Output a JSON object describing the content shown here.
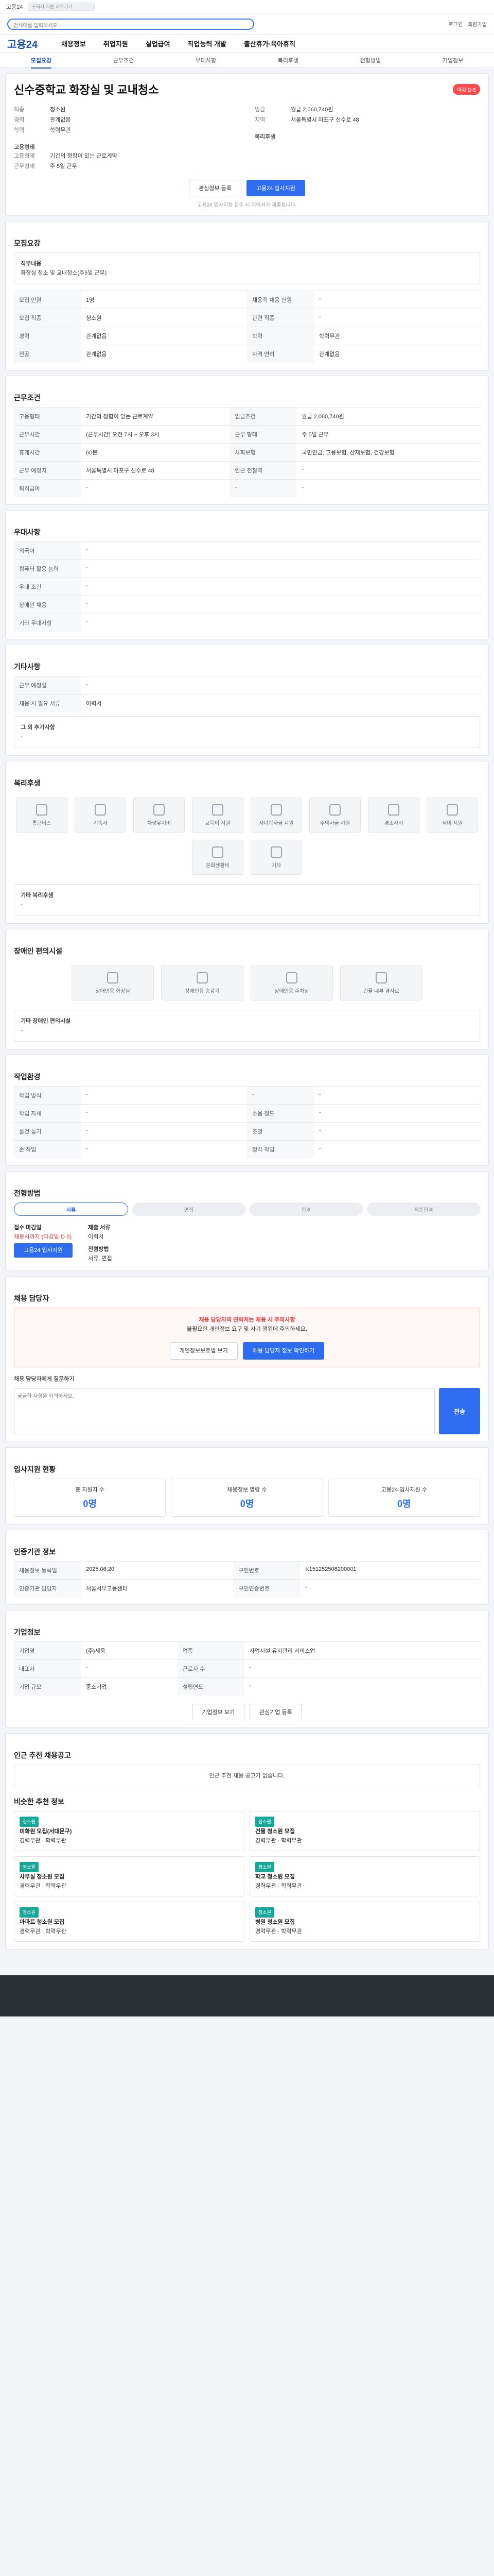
{
  "topbar": {
    "logo": "고용24",
    "notice": "구직자 지원 바로가기"
  },
  "header": {
    "search_placeholder": "검색어를 입력하세요",
    "links": [
      "로그인",
      "회원가입"
    ]
  },
  "nav": {
    "org": "고용24",
    "items": [
      "채용정보",
      "취업지원",
      "실업급여",
      "직업능력 개발",
      "출산휴가·육아휴직"
    ]
  },
  "tabs": [
    "모집요강",
    "근무조건",
    "우대사항",
    "복리후생",
    "전형방법",
    "기업정보"
  ],
  "job": {
    "title": "신수중학교 화장실 및 교내청소",
    "badge": "마감 D-5",
    "left": [
      {
        "k": "직종",
        "v": "청소원"
      },
      {
        "k": "경력",
        "v": "관계없음"
      },
      {
        "k": "학력",
        "v": "학력무관"
      }
    ],
    "right": [
      {
        "k": "임금",
        "v": "월급 2,060,740원"
      },
      {
        "k": "지역",
        "v": "서울특별시 마포구 신수로 48"
      }
    ],
    "type_label": "고용형태",
    "type_rows": [
      {
        "k": "고용형태",
        "v": "기간의 정함이 있는 근로계약"
      },
      {
        "k": "근무형태",
        "v": "주 5일 근무"
      }
    ],
    "extra_label": "복리후생",
    "btn_scrap": "관심정보 등록",
    "btn_apply": "고용24 입사지원",
    "apply_note": "고용24 입사지원 접수 시 이력서가 제출됩니다."
  },
  "recruit": {
    "title": "모집요강",
    "duty_label": "직무내용",
    "duty": "화장실 청소 및 교내청소(주5일 근무)",
    "rows": [
      [
        "모집 인원",
        "1명",
        "채용직 채용 인원",
        "-"
      ],
      [
        "모집 직종",
        "청소원",
        "관련 직종",
        "-"
      ],
      [
        "경력",
        "관계없음",
        "학력",
        "학력무관"
      ],
      [
        "전공",
        "관계없음",
        "자격 면허",
        "관계없음"
      ]
    ]
  },
  "conditions": {
    "title": "근무조건",
    "rows": [
      [
        "고용형태",
        "기간의 정함이 있는 근로계약",
        "임금조건",
        "월급 2,060,740원"
      ],
      [
        "근무시간",
        "(근무시간) 오전 7시 ~ 오후 3시",
        "근무 형태",
        "주 5일 근무"
      ],
      [
        "휴게시간",
        "60분",
        "사회보험",
        "국민연금, 고용보험, 산재보험, 건강보험"
      ],
      [
        "근무 예정지",
        "서울특별시 마포구 신수로 48",
        "인근 전철역",
        "-"
      ],
      [
        "퇴직급여",
        "-",
        "-",
        "-"
      ]
    ]
  },
  "preferences": {
    "title": "우대사항",
    "rows": [
      [
        "외국어",
        "-"
      ],
      [
        "컴퓨터 활용 능력",
        "-"
      ],
      [
        "우대 조건",
        "-"
      ],
      [
        "장애인 채용",
        "-"
      ],
      [
        "기타 우대사항",
        "-"
      ]
    ]
  },
  "etc": {
    "title": "기타사항",
    "rows": [
      [
        "근무 예정일",
        "-"
      ],
      [
        "채용 시 필요 서류",
        "이력서"
      ]
    ],
    "extra_label": "그 외 추가사항",
    "extra": "-"
  },
  "welfare": {
    "title": "복리후생",
    "items": [
      "통근버스",
      "기숙사",
      "차량유지비",
      "교육비 지원",
      "자녀학자금 지원",
      "주택자금 지원",
      "경조사비",
      "식비 지원",
      "문화생활비",
      "기타"
    ],
    "other_label": "기타 복리후생",
    "other": "-"
  },
  "disability": {
    "title": "장애인 편의시설",
    "items": [
      "장애인용 화장실",
      "장애인용 승강기",
      "장애인용 주차장",
      "건물 내부 경사로"
    ],
    "other_label": "기타 장애인 편의시설",
    "other": "-"
  },
  "environment": {
    "title": "작업환경",
    "rows": [
      [
        "작업 방식",
        "-",
        "-",
        "-"
      ],
      [
        "작업 자세",
        "-",
        "소음 정도",
        "-"
      ],
      [
        "물건 들기",
        "-",
        "조명",
        "-"
      ],
      [
        "손 작업",
        "-",
        "청각 작업",
        "-"
      ]
    ]
  },
  "selection": {
    "title": "전형방법",
    "steps": [
      "서류",
      "면접",
      "합격",
      "최종합격"
    ],
    "left_label": "접수 마감일",
    "deadline": "채용시까지 (마감일 D-5)",
    "apply_btn": "고용24 입사지원",
    "right_label": "제출 서류",
    "docs": "이력서",
    "method_label": "전형방법",
    "method": "서류, 면접"
  },
  "inquiry": {
    "title": "채용 담당자",
    "warn1": "채용 담당자의 연락처는 채용 시 주의사항",
    "warn2": "불필요한 개인정보 요구 및 사기 행위에 주의하세요.",
    "btn1": "개인정보보호법 보기",
    "btn2": "채용 담당자 정보 확인하기",
    "qa_label": "채용 담당자에게 질문하기",
    "placeholder": "궁금한 사항을 입력하세요.",
    "send": "전송"
  },
  "applicants": {
    "title": "입사지원 현황",
    "stats": [
      {
        "label": "총 지원자 수",
        "n": "0명"
      },
      {
        "label": "채용정보 열람 수",
        "n": "0명"
      },
      {
        "label": "고용24 입사지원 수",
        "n": "0명"
      }
    ]
  },
  "info": {
    "title": "인증기관 정보",
    "rows": [
      [
        "채용정보 등록일",
        "2025.06.20",
        "구인번호",
        "K151252506200001"
      ],
      [
        "인증기관 담당자",
        "서울서부고용센터",
        "구인인증번호",
        "-"
      ]
    ]
  },
  "company": {
    "title": "기업정보",
    "rows": [
      [
        "기업명",
        "(주)세움",
        "업종",
        "사업시설 유지관리 서비스업"
      ],
      [
        "대표자",
        "-",
        "근로자 수",
        "-"
      ],
      [
        "기업 규모",
        "중소기업",
        "설립연도",
        "-"
      ]
    ],
    "btns": [
      "기업정보 보기",
      "관심기업 등록"
    ]
  },
  "related": {
    "title": "인근 추천 채용공고",
    "note": "인근 추천 채용 공고가 없습니다.",
    "second_title": "비슷한 추천 정보",
    "jobs": [
      {
        "tag": "청소원",
        "t": "미화원 모집(서대문구)",
        "d": "경력무관 · 학력무관"
      },
      {
        "tag": "청소원",
        "t": "건물 청소원 모집",
        "d": "경력무관 · 학력무관"
      },
      {
        "tag": "청소원",
        "t": "사무실 청소원 모집",
        "d": "경력무관 · 학력무관"
      },
      {
        "tag": "청소원",
        "t": "학교 청소원 모집",
        "d": "경력무관 · 학력무관"
      },
      {
        "tag": "청소원",
        "t": "아파트 청소원 모집",
        "d": "경력무관 · 학력무관"
      },
      {
        "tag": "청소원",
        "t": "병원 청소원 모집",
        "d": "경력무관 · 학력무관"
      }
    ]
  }
}
